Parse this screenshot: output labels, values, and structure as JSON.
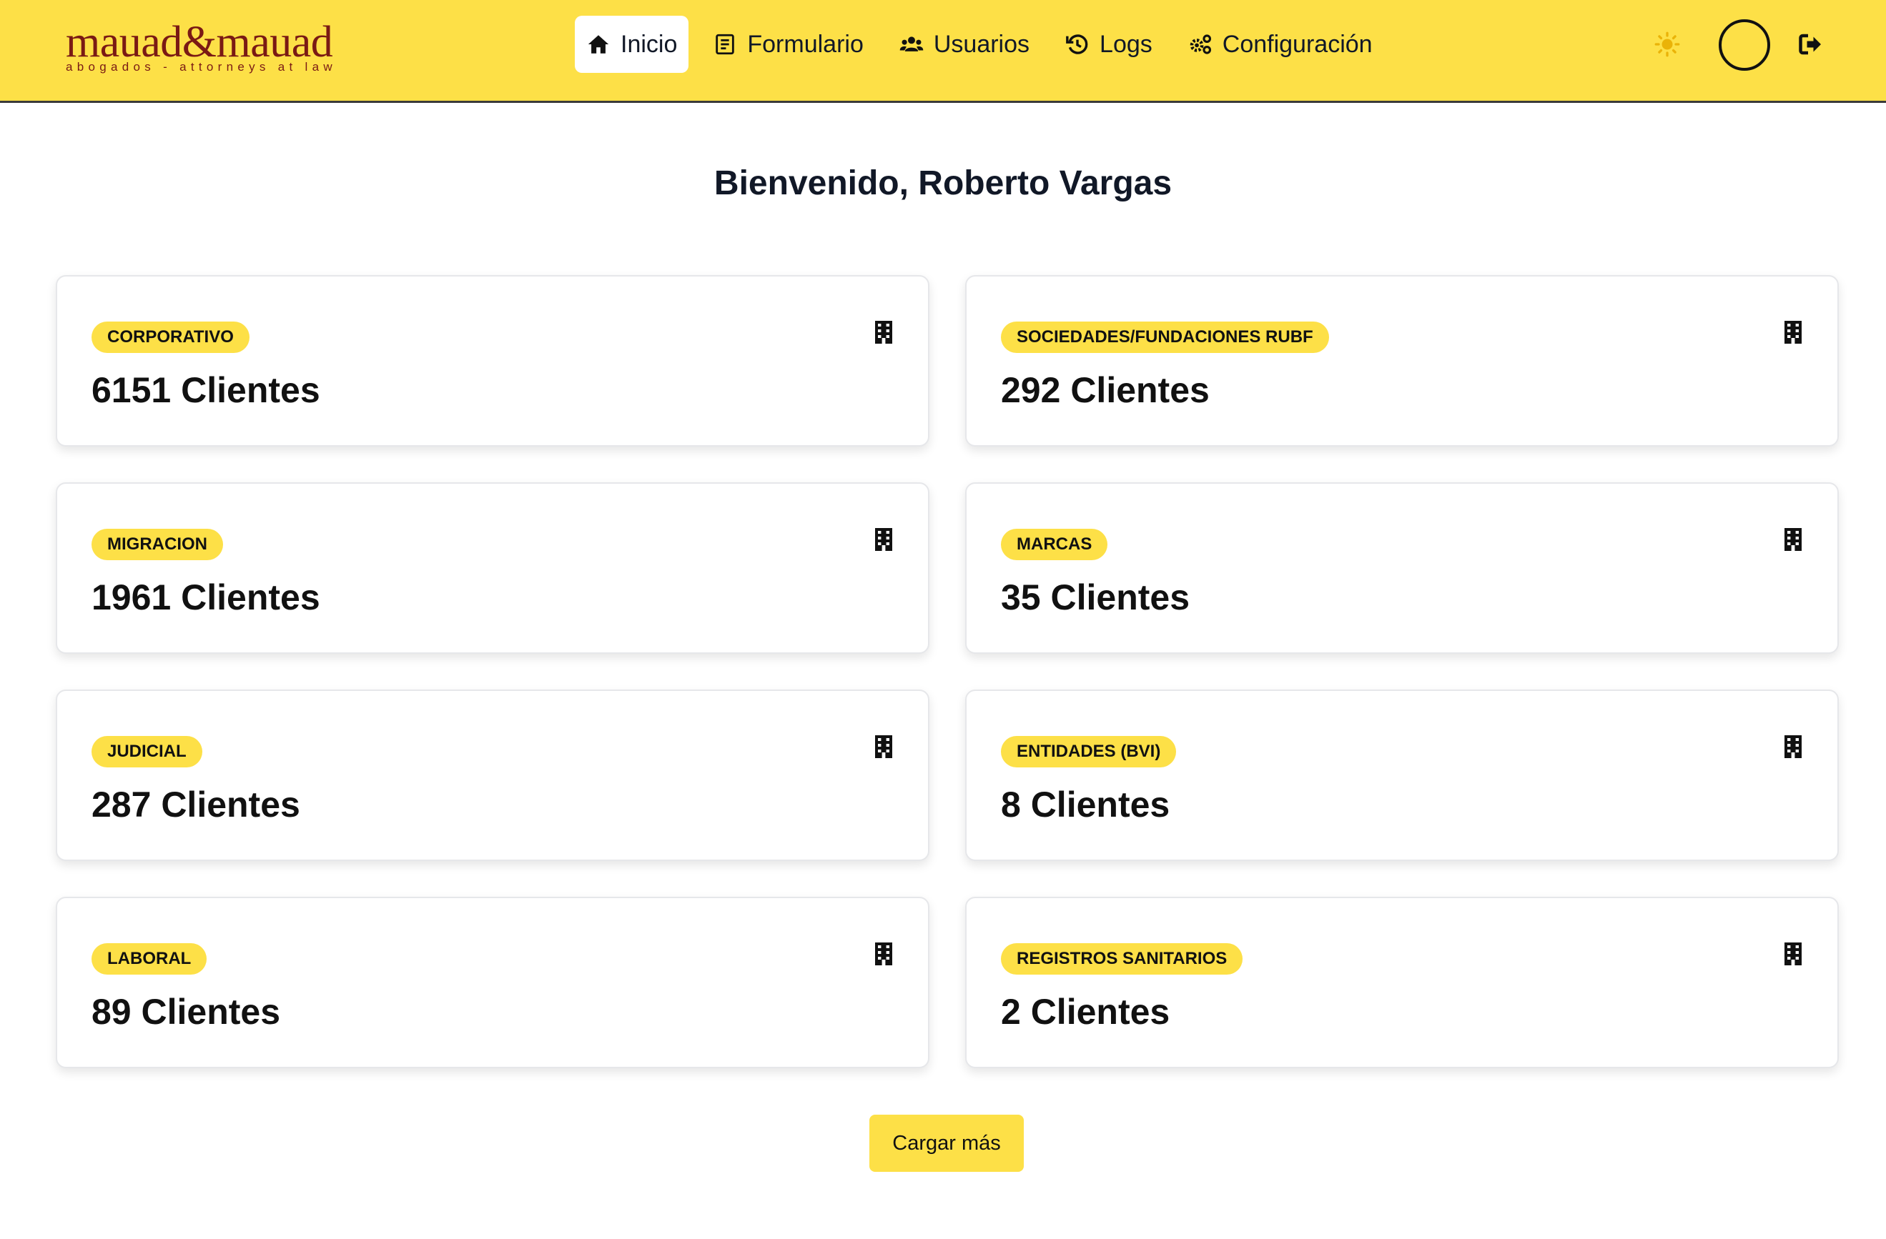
{
  "header": {
    "logo": {
      "main": "mauad&mauad",
      "tagline": "abogados - attorneys at law"
    },
    "nav": [
      {
        "label": "Inicio",
        "icon": "home-icon",
        "active": true
      },
      {
        "label": "Formulario",
        "icon": "form-icon",
        "active": false
      },
      {
        "label": "Usuarios",
        "icon": "users-icon",
        "active": false
      },
      {
        "label": "Logs",
        "icon": "history-icon",
        "active": false
      },
      {
        "label": "Configuración",
        "icon": "gears-icon",
        "active": false
      }
    ],
    "theme_icon": "sun-icon",
    "avatar_icon": "avatar",
    "logout_icon": "logout-icon",
    "accent_color": "#fde047"
  },
  "main": {
    "welcome": "Bienvenido, Roberto Vargas",
    "cards": [
      {
        "badge": "CORPORATIVO",
        "count": "6151 Clientes",
        "icon": "building-icon"
      },
      {
        "badge": "SOCIEDADES/FUNDACIONES RUBF",
        "count": "292 Clientes",
        "icon": "building-icon"
      },
      {
        "badge": "MIGRACION",
        "count": "1961 Clientes",
        "icon": "building-icon"
      },
      {
        "badge": "MARCAS",
        "count": "35 Clientes",
        "icon": "building-icon"
      },
      {
        "badge": "JUDICIAL",
        "count": "287 Clientes",
        "icon": "building-icon"
      },
      {
        "badge": "ENTIDADES (BVI)",
        "count": "8 Clientes",
        "icon": "building-icon"
      },
      {
        "badge": "LABORAL",
        "count": "89 Clientes",
        "icon": "building-icon"
      },
      {
        "badge": "REGISTROS SANITARIOS",
        "count": "2 Clientes",
        "icon": "building-icon"
      }
    ],
    "load_more_label": "Cargar más"
  }
}
